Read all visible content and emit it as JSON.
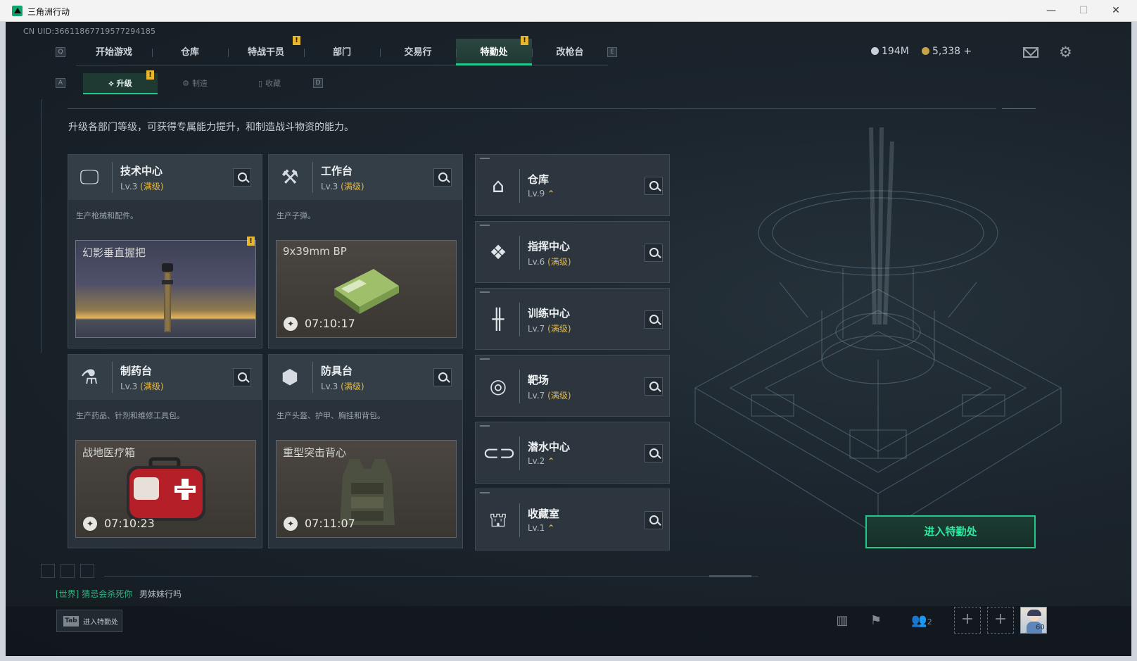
{
  "window": {
    "title": "三角洲行动",
    "controls": {
      "minimize": "—",
      "maximize": "☐",
      "close": "✕"
    }
  },
  "uid": "CN UID:3661186771957729418​5",
  "nav": {
    "left_key": "Q",
    "right_key": "E",
    "tabs": [
      {
        "label": "开始游戏",
        "badge": ""
      },
      {
        "label": "仓库",
        "badge": ""
      },
      {
        "label": "特战干员",
        "badge": "!"
      },
      {
        "label": "部门",
        "badge": ""
      },
      {
        "label": "交易行",
        "badge": ""
      },
      {
        "label": "特勤处",
        "badge": "!",
        "active": true
      },
      {
        "label": "改枪台",
        "badge": ""
      }
    ]
  },
  "currency": {
    "balance_a": "194M",
    "balance_b": "5,338",
    "add_symbol": "+"
  },
  "icons": {
    "mail": "mail-icon",
    "settings": "gear-icon"
  },
  "subnav": {
    "left_key": "A",
    "right_key": "D",
    "tabs": [
      {
        "label": "升级",
        "icon": "upgrade-icon",
        "active": true,
        "badge": "!"
      },
      {
        "label": "制造",
        "icon": "craft-icon",
        "active": false
      },
      {
        "label": "收藏",
        "icon": "collection-icon",
        "active": false
      }
    ]
  },
  "description": "升级各部门等级，可获得专属能力提升，和制造战斗物资的能力。",
  "production": [
    {
      "name": "技术中心",
      "level": "Lv.3",
      "max": "(满级)",
      "desc": "生产枪械和配件。",
      "item": "幻影垂直握把",
      "timer": "",
      "icon": "monitor-icon",
      "badge": "!"
    },
    {
      "name": "工作台",
      "level": "Lv.3",
      "max": "(满级)",
      "desc": "生产子弹。",
      "item": "9x39mm BP",
      "timer": "07:10:17",
      "icon": "tools-icon",
      "badge": ""
    },
    {
      "name": "制药台",
      "level": "Lv.3",
      "max": "(满级)",
      "desc": "生产药品、针剂和维修工具包。",
      "item": "战地医疗箱",
      "timer": "07:10:23",
      "icon": "microscope-icon",
      "badge": ""
    },
    {
      "name": "防具台",
      "level": "Lv.3",
      "max": "(满级)",
      "desc": "生产头盔、护甲、胸挂和背包。",
      "item": "重型突击背心",
      "timer": "07:11:07",
      "icon": "armor-icon",
      "badge": ""
    }
  ],
  "facilities": [
    {
      "name": "仓库",
      "level": "Lv.9",
      "max": "",
      "upgradable": "⌃",
      "icon": "warehouse-icon"
    },
    {
      "name": "指挥中心",
      "level": "Lv.6",
      "max": "(满级)",
      "upgradable": "",
      "icon": "command-icon"
    },
    {
      "name": "训练中心",
      "level": "Lv.7",
      "max": "(满级)",
      "upgradable": "",
      "icon": "dumbbell-icon"
    },
    {
      "name": "靶场",
      "level": "Lv.7",
      "max": "(满级)",
      "upgradable": "",
      "icon": "target-icon"
    },
    {
      "name": "潜水中心",
      "level": "Lv.2",
      "max": "",
      "upgradable": "⌃",
      "icon": "goggles-icon"
    },
    {
      "name": "收藏室",
      "level": "Lv.1",
      "max": "",
      "upgradable": "⌃",
      "icon": "vault-icon"
    }
  ],
  "enter_button": "进入特勤处",
  "chat": {
    "channel": "[世界]",
    "sender": "猜忌会杀死你",
    "message": "男妹妹行吗"
  },
  "bottom": {
    "tab_key": "Tab",
    "tab_label": "进入特勤处",
    "party_count": "2",
    "player_level": "60"
  },
  "colors": {
    "accent": "#20c98a",
    "badge": "#e8b62c",
    "max_level": "#e1b84a"
  }
}
